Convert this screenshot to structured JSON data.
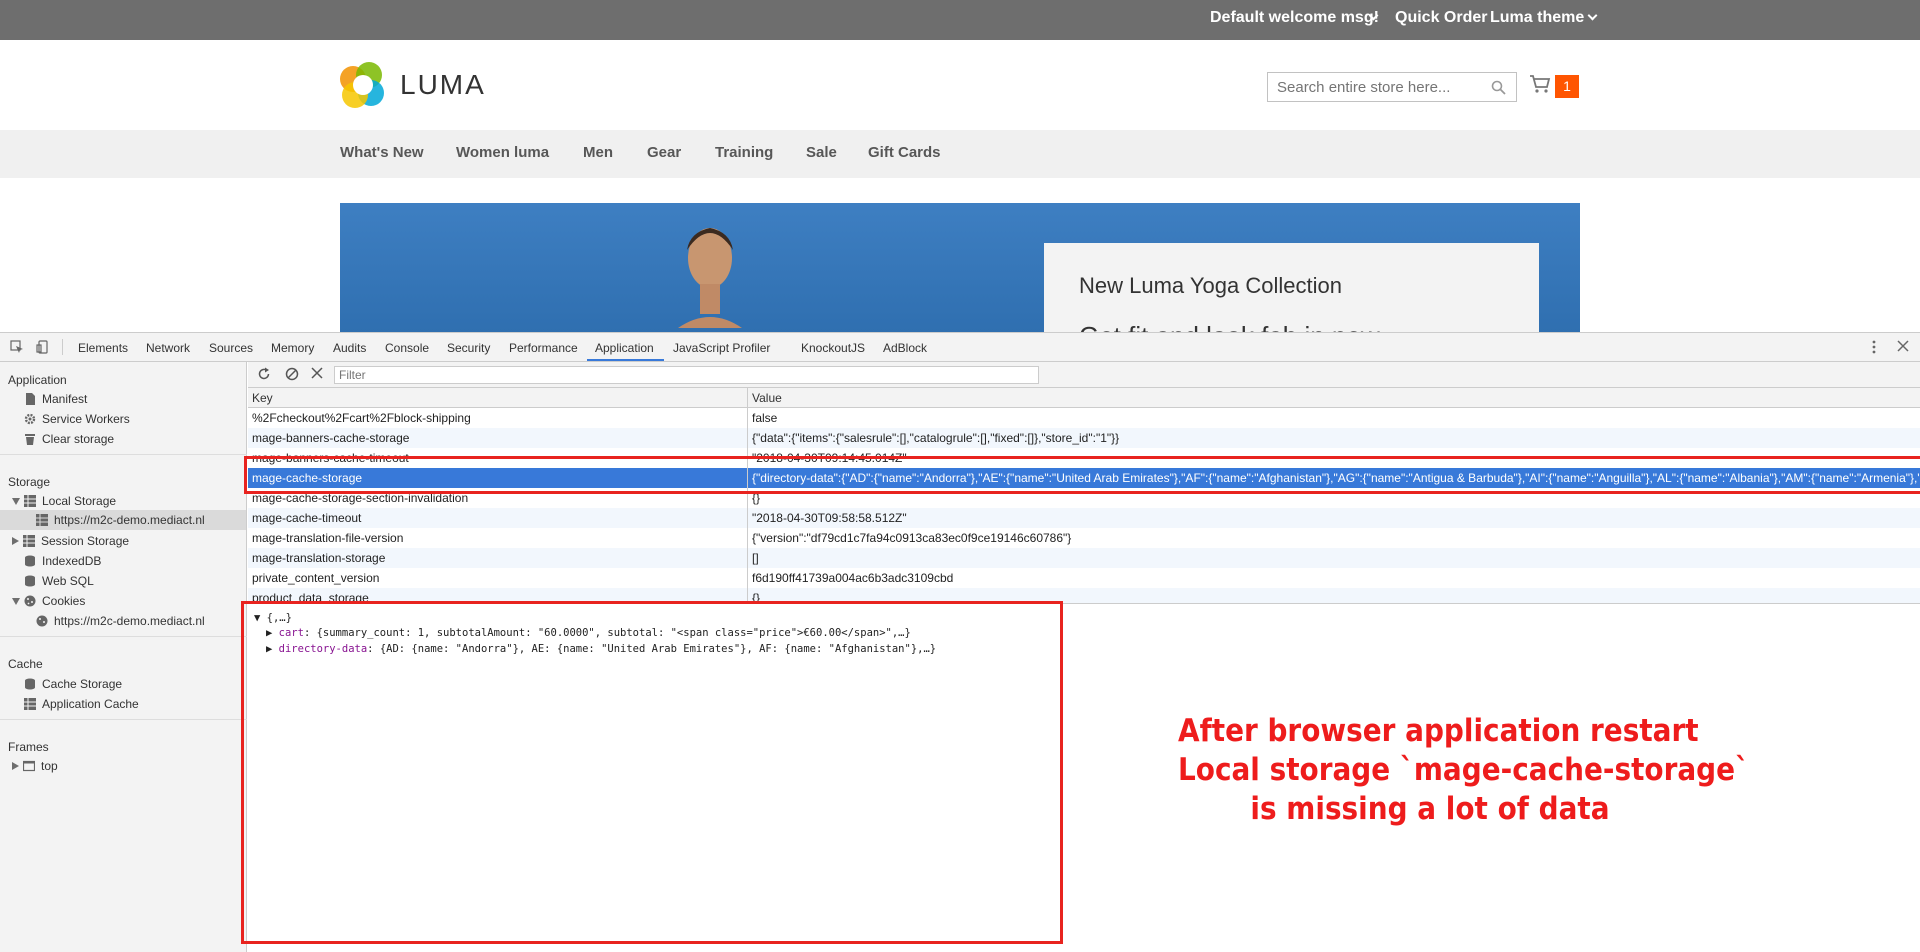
{
  "site": {
    "welcome": "Default welcome msg!",
    "quick_order": "Quick Order",
    "theme": "Luma theme",
    "logo_text": "LUMA",
    "search_placeholder": "Search entire store here...",
    "cart_count": "1",
    "nav": [
      "What's New",
      "Women luma",
      "Men",
      "Gear",
      "Training",
      "Sale",
      "Gift Cards"
    ],
    "hero_title": "New Luma Yoga Collection",
    "hero_subtitle": "Get fit and look fab in new",
    "colors": {
      "topbar": "#6e6e6e",
      "accent": "#ff5501",
      "nav_bg": "#f0f0f0"
    }
  },
  "devtools": {
    "tabs": [
      "Elements",
      "Network",
      "Sources",
      "Memory",
      "Audits",
      "Console",
      "Security",
      "Performance",
      "Application",
      "JavaScript Profiler",
      "KnockoutJS",
      "AdBlock"
    ],
    "active_tab": "Application",
    "sidebar": {
      "application_header": "Application",
      "application_items": [
        "Manifest",
        "Service Workers",
        "Clear storage"
      ],
      "storage_header": "Storage",
      "local_storage": "Local Storage",
      "local_storage_origin": "https://m2c-demo.mediact.nl",
      "session_storage": "Session Storage",
      "indexeddb": "IndexedDB",
      "websql": "Web SQL",
      "cookies": "Cookies",
      "cookies_origin": "https://m2c-demo.mediact.nl",
      "cache_header": "Cache",
      "cache_storage": "Cache Storage",
      "application_cache": "Application Cache",
      "frames_header": "Frames",
      "frames_top": "top"
    },
    "filter_placeholder": "Filter",
    "columns": {
      "key": "Key",
      "value": "Value"
    },
    "rows": [
      {
        "key": "%2Fcheckout%2Fcart%2Fblock-shipping",
        "value": "false"
      },
      {
        "key": "mage-banners-cache-storage",
        "value": "{\"data\":{\"items\":{\"salesrule\":[],\"catalogrule\":[],\"fixed\":[]},\"store_id\":\"1\"}}"
      },
      {
        "key": "mage-banners-cache-timeout",
        "value": "\"2018-04-30T09:14:45.014Z\""
      },
      {
        "key": "mage-cache-storage",
        "value": "{\"directory-data\":{\"AD\":{\"name\":\"Andorra\"},\"AE\":{\"name\":\"United Arab Emirates\"},\"AF\":{\"name\":\"Afghanistan\"},\"AG\":{\"name\":\"Antigua & Barbuda\"},\"AI\":{\"name\":\"Anguilla\"},\"AL\":{\"name\":\"Albania\"},\"AM\":{\"name\":\"Armenia\"},\"A..."
      },
      {
        "key": "mage-cache-storage-section-invalidation",
        "value": "{}"
      },
      {
        "key": "mage-cache-timeout",
        "value": "\"2018-04-30T09:58:58.512Z\""
      },
      {
        "key": "mage-translation-file-version",
        "value": "{\"version\":\"df79cd1c7fa94c0913ca83ec0f9ce19146c60786\"}"
      },
      {
        "key": "mage-translation-storage",
        "value": "[]"
      },
      {
        "key": "private_content_version",
        "value": "f6d190ff41739a004ac6b3adc3109cbd"
      },
      {
        "key": "product_data_storage",
        "value": "{}"
      }
    ],
    "selected_row": 3,
    "preview": {
      "root": "{,…}",
      "line1_key": "cart",
      "line1_rest": ": {summary_count: 1, subtotalAmount: \"60.0000\", subtotal: \"<span class=\"price\">€60.00</span>\",…}",
      "line2_key": "directory-data",
      "line2_rest": ": {AD: {name: \"Andorra\"}, AE: {name: \"United Arab Emirates\"}, AF: {name: \"Afghanistan\"},…}"
    }
  },
  "annotation": {
    "lines": [
      "After browser application restart",
      "Local storage `mage-cache-storage`",
      "is missing a lot of data"
    ],
    "color": "#ee1c1c"
  }
}
